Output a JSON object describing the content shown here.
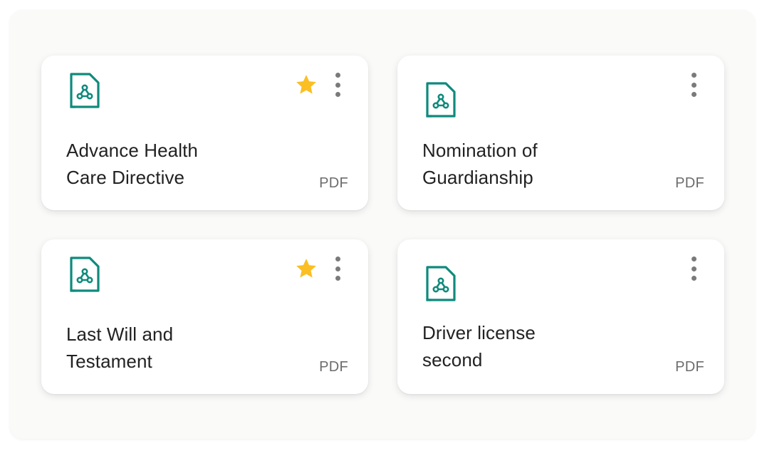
{
  "cards": [
    {
      "title_line1": "Advance Health",
      "title_line2": "Care Directive",
      "file_type": "PDF",
      "starred": true
    },
    {
      "title_line1": "Nomination of",
      "title_line2": "Guardianship",
      "file_type": "PDF",
      "starred": false
    },
    {
      "title_line1": "Last Will and",
      "title_line2": "Testament",
      "file_type": "PDF",
      "starred": true
    },
    {
      "title_line1": "Driver license",
      "title_line2": "second",
      "file_type": "PDF",
      "starred": false
    }
  ],
  "icons": {
    "file": "pdf-file-icon",
    "star": "star-icon",
    "menu": "more-vertical-icon"
  },
  "colors": {
    "accent": "#0f8a7c",
    "star": "#fbbf24",
    "panel_background": "#fafaf9"
  }
}
